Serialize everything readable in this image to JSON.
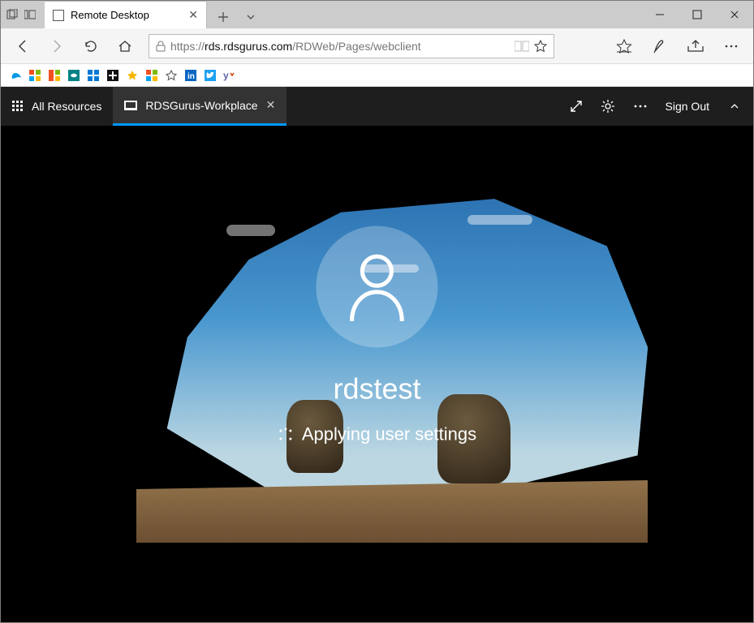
{
  "browser": {
    "tab_title": "Remote Desktop",
    "url_scheme": "https://",
    "url_host": "rds.rdsgurus.com",
    "url_path": "/RDWeb/Pages/webclient"
  },
  "rd": {
    "all_resources_label": "All Resources",
    "session_tab_title": "RDSGurus-Workplace",
    "sign_out_label": "Sign Out"
  },
  "login": {
    "username": "rdstest",
    "status_text": "Applying user settings"
  },
  "icons": {
    "fav_colors": [
      "#0099e5",
      "#f25022",
      "#7fba00",
      "#00a4ef",
      "#ffb900",
      "#038387",
      "#0078d4",
      "#222",
      "#f7b500",
      "#ff6a00",
      "#888",
      "#0a66c2",
      "#1da1f2",
      "#6264a7"
    ]
  }
}
